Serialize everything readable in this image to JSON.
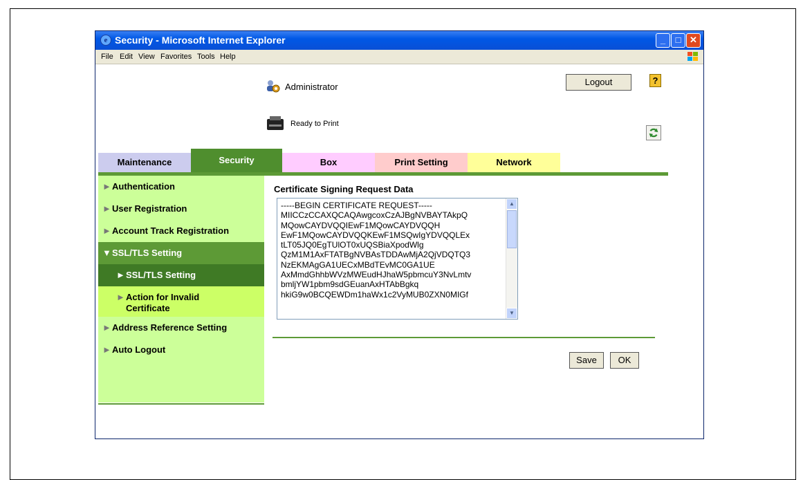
{
  "window": {
    "title": "Security - Microsoft Internet Explorer",
    "controls": {
      "minimize": "_",
      "maximize": "□",
      "close": "✕"
    }
  },
  "menu": [
    "File",
    "Edit",
    "View",
    "Favorites",
    "Tools",
    "Help"
  ],
  "header": {
    "user": "Administrator",
    "logout_label": "Logout",
    "help_label": "?",
    "status": "Ready to Print"
  },
  "tabs": [
    {
      "label": "Maintenance",
      "color": "#ccccee"
    },
    {
      "label": "Security",
      "color": "#4f8e2e",
      "active": true
    },
    {
      "label": "Box",
      "color": "#ffccff"
    },
    {
      "label": "Print Setting",
      "color": "#ffcccc"
    },
    {
      "label": "Network",
      "color": "#ffff99"
    }
  ],
  "sidebar": {
    "items": [
      {
        "label": "Authentication",
        "arrow": "►"
      },
      {
        "label": "User Registration",
        "arrow": "►"
      },
      {
        "label": "Account Track Registration",
        "arrow": "►"
      },
      {
        "label": "SSL/TLS Setting",
        "arrow": "▼"
      },
      {
        "label": "SSL/TLS Setting",
        "arrow": "►"
      },
      {
        "label": "Action for Invalid Certificate",
        "arrow": "►"
      },
      {
        "label": "Address Reference Setting",
        "arrow": "►"
      },
      {
        "label": "Auto Logout",
        "arrow": "►"
      }
    ]
  },
  "main": {
    "title": "Certificate Signing Request Data",
    "csr_lines": [
      "-----BEGIN CERTIFICATE REQUEST-----",
      "MIICCzCCAXQCAQAwgcoxCzAJBgNVBAYTAkpQ",
      "MQowCAYDVQQIEwF1MQowCAYDVQQH",
      "EwF1MQowCAYDVQQKEwF1MSQwIgYDVQQLEx",
      "tLT05JQ0EgTUlOT0xUQSBiaXpodWlg",
      "QzM1M1AxFTATBgNVBAsTDDAwMjA2QjVDQTQ3",
      "NzEKMAgGA1UECxMBdTEvMC0GA1UE",
      "AxMmdGhhbWVzMWEudHJhaW5pbmcuY3NvLmtv",
      "bmljYW1pbm9sdGEuanAxHTAbBgkq",
      "hkiG9w0BCQEWDm1haWx1c2VyMUB0ZXN0MIGf"
    ],
    "save_label": "Save",
    "ok_label": "OK"
  },
  "colors": {
    "security_green": "#5d9a36",
    "sidebar_light": "#ccff99",
    "sidebar_sub": "#ccff66",
    "titlebar": "#0058e6"
  }
}
